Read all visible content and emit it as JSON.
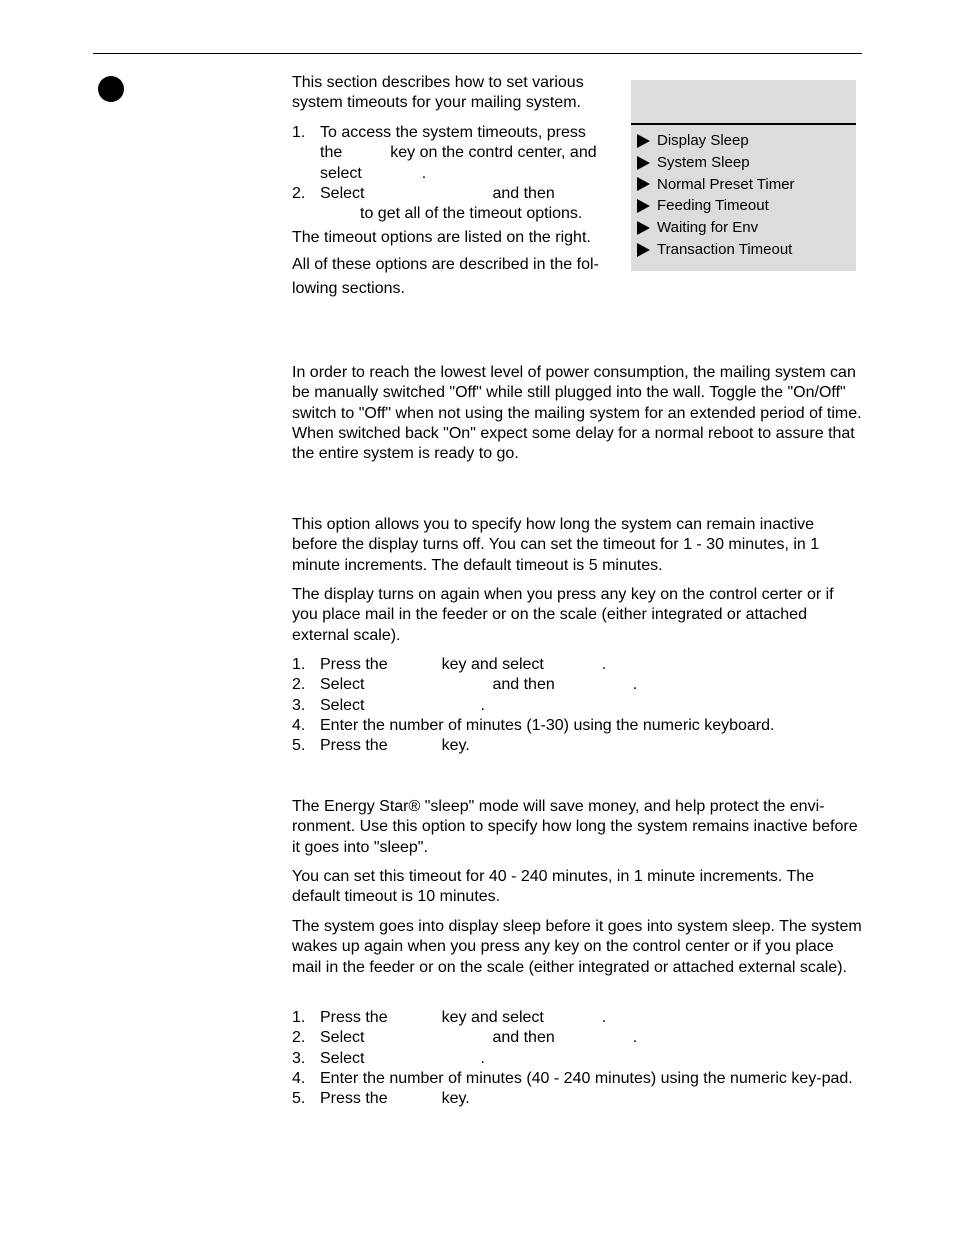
{
  "intro": {
    "paragraph": "This section describes how to set various system timeouts for your mailing system.",
    "steps": [
      {
        "num": "1.",
        "parts": [
          "To access the system timeouts, press",
          "the",
          "key on the contrd center, and",
          "select",
          "."
        ]
      },
      {
        "num": "2.",
        "parts": [
          "Select",
          "and then",
          "to get all of the timeout options."
        ]
      }
    ],
    "note1": "The timeout options are listed on the right.",
    "note2": "All of these options are described in the fol-lowing sections."
  },
  "sidebar": {
    "items": [
      {
        "label": "Display Sleep",
        "icon": "triangle-right-icon"
      },
      {
        "label": "System Sleep",
        "icon": "triangle-right-icon"
      },
      {
        "label": "Normal Preset Timer",
        "icon": "triangle-right-icon"
      },
      {
        "label": "Feeding Timeout",
        "icon": "triangle-right-icon"
      },
      {
        "label": "Waiting for Env",
        "icon": "triangle-right-icon"
      },
      {
        "label": "Transaction Timeout",
        "icon": "triangle-right-icon"
      }
    ]
  },
  "power": {
    "paragraph": "In order to reach the lowest level of power consumption, the mailing system can be manually switched \"Off\" while still plugged into the wall. Toggle the \"On/Off\" switch to \"Off\" when not using the mailing system for an extended period of time. When switched back \"On\" expect some delay for a normal reboot to assure that the entire system is ready to go."
  },
  "display_sleep": {
    "p1": "This option allows you to specify how long the system can remain inactive before the display turns off. You can set the timeout for 1 - 30 minutes, in 1 minute increments. The default timeout is 5 minutes.",
    "p2": "The display turns on again when you press any key on the control certer or if you place mail in the feeder or on the scale (either integrated or attached external scale).",
    "steps": [
      {
        "num": "1.",
        "a": "Press the",
        "b": "key and select",
        "c": "."
      },
      {
        "num": "2.",
        "a": "Select",
        "b": "and then",
        "c": "."
      },
      {
        "num": "3.",
        "a": "Select",
        "b": "."
      },
      {
        "num": "4.",
        "a": "Enter the number of minutes (1-30) using the numeric keyboard."
      },
      {
        "num": "5.",
        "a": "Press the",
        "b": "key."
      }
    ]
  },
  "system_sleep": {
    "p1": "The Energy Star® \"sleep\" mode will save money, and help protect the envi-ronment. Use this option to specify how long the system remains inactive before it goes into \"sleep\".",
    "p2": "You can set this timeout for 40 - 240 minutes, in 1 minute increments. The default timeout is 10 minutes.",
    "p3": "The system goes into display sleep before it goes into system sleep. The system wakes up again when you press any key on the control center or if you place mail in the feeder or on the scale (either integrated or attached external scale).",
    "steps": [
      {
        "num": "1.",
        "a": "Press the",
        "b": "key and select",
        "c": "."
      },
      {
        "num": "2.",
        "a": "Select",
        "b": "and then",
        "c": "."
      },
      {
        "num": "3.",
        "a": "Select",
        "b": "."
      },
      {
        "num": "4.",
        "a": "Enter the number of minutes (40 - 240 minutes) using the numeric key-pad."
      },
      {
        "num": "5.",
        "a": "Press the",
        "b": "key."
      }
    ]
  }
}
